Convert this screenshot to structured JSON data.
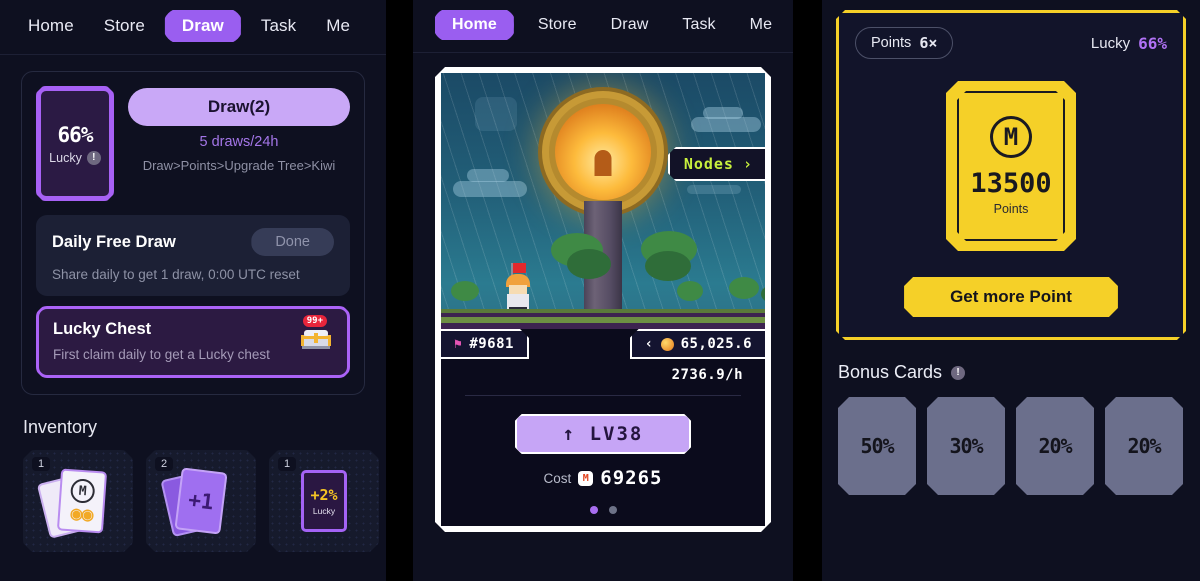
{
  "panels": {
    "draw": {
      "nav": {
        "items": [
          "Home",
          "Store",
          "Draw",
          "Task",
          "Me"
        ],
        "active": "Draw"
      },
      "lucky_tile": {
        "percent": "66%",
        "label": "Lucky",
        "info_icon": "info-icon",
        "info_glyph": "!"
      },
      "draw_button": "Draw(2)",
      "draws_line": "5  draws/24h",
      "path_line": "Draw>Points>Upgrade  Tree>Kiwi",
      "daily": {
        "title": "Daily Free Draw",
        "button": "Done",
        "desc": "Share daily to get 1 draw, 0:00 UTC reset"
      },
      "chest": {
        "title": "Lucky Chest",
        "desc": "First claim daily to get a Lucky chest",
        "badge": "99+",
        "icon": "treasure-chest-icon"
      },
      "inventory": {
        "title": "Inventory",
        "items": [
          {
            "count": "1",
            "kind": "points-card",
            "logo": "M",
            "art": "coin-stack-icon"
          },
          {
            "count": "2",
            "kind": "draw-card",
            "value": "+1"
          },
          {
            "count": "1",
            "kind": "lucky-card",
            "value": "+2%",
            "label": "Lucky"
          }
        ]
      }
    },
    "home": {
      "nav": {
        "items": [
          "Home",
          "Store",
          "Draw",
          "Task",
          "Me"
        ],
        "active": "Home"
      },
      "nodes_badge": {
        "label": "Nodes",
        "chevron": "›"
      },
      "stats": {
        "rank_icon": "flag-icon",
        "rank": "#9681",
        "coin_icon": "coin-icon",
        "chevron": "‹",
        "balance": "65,025.6",
        "rate": "2736.9/h"
      },
      "level_button": {
        "arrow": "↑",
        "label": "LV38"
      },
      "cost": {
        "label": "Cost",
        "token_icon": "M",
        "value": "69265"
      },
      "pagination": {
        "count": 2,
        "active_index": 0
      }
    },
    "points": {
      "points_chip": {
        "label": "Points",
        "value": "6×"
      },
      "lucky": {
        "label": "Lucky",
        "value": "66%"
      },
      "card": {
        "logo": "M",
        "amount": "13500",
        "unit": "Points"
      },
      "get_more_button": "Get more Point",
      "bonus": {
        "title": "Bonus Cards",
        "info_glyph": "!",
        "cards": [
          "50%",
          "30%",
          "20%",
          "20%"
        ]
      }
    }
  },
  "colors": {
    "accent_purple": "#9a5ef0",
    "accent_yellow": "#f5d028",
    "nodes_green": "#c8f03d",
    "panel_bg": "#0e1020",
    "badge_red": "#e8253b"
  }
}
